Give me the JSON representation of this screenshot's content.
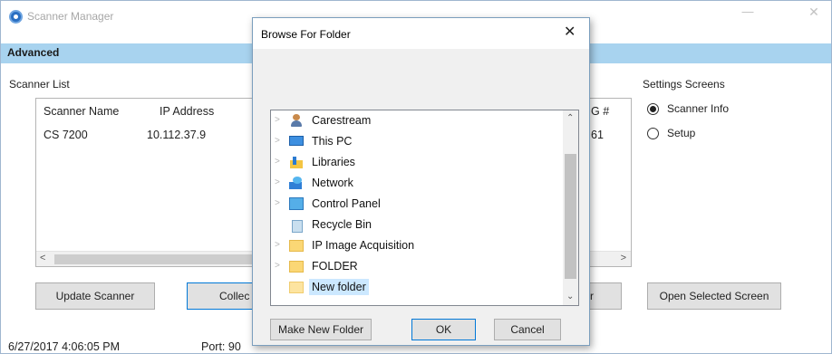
{
  "main_window": {
    "title": "Scanner Manager",
    "minimize_glyph": "—",
    "close_glyph": "✕",
    "tab": "Advanced",
    "scanner_list": {
      "label": "Scanner List",
      "columns": [
        "Scanner Name",
        "IP Address",
        "G #"
      ],
      "rows": [
        {
          "name": "CS 7200",
          "ip": "10.112.37.9",
          "partial": "61"
        }
      ],
      "scroll_left": "<",
      "scroll_right": ">"
    },
    "settings_screens": {
      "label": "Settings Screens",
      "options": [
        {
          "label": "Scanner Info",
          "checked": true
        },
        {
          "label": "Setup",
          "checked": false
        }
      ]
    },
    "buttons": {
      "update_scanner": "Update Scanner",
      "collect_partial": "Collec",
      "right_partial": "r",
      "open_selected_screen": "Open Selected Screen"
    },
    "status": {
      "timestamp": "6/27/2017 4:06:05 PM",
      "port": "Port: 90"
    }
  },
  "dialog": {
    "title": "Browse For Folder",
    "close_glyph": "✕",
    "tree": [
      {
        "label": "Carestream",
        "icon": "person-folder-icon",
        "expandable": true,
        "selected": false
      },
      {
        "label": "This PC",
        "icon": "computer-icon",
        "expandable": true,
        "selected": false
      },
      {
        "label": "Libraries",
        "icon": "libraries-icon",
        "expandable": true,
        "selected": false
      },
      {
        "label": "Network",
        "icon": "network-icon",
        "expandable": true,
        "selected": false
      },
      {
        "label": "Control Panel",
        "icon": "control-panel-icon",
        "expandable": true,
        "selected": false
      },
      {
        "label": "Recycle Bin",
        "icon": "recycle-bin-icon",
        "expandable": false,
        "selected": false
      },
      {
        "label": "IP Image Acquisition",
        "icon": "folder-icon",
        "expandable": true,
        "selected": false
      },
      {
        "label": "FOLDER",
        "icon": "folder-icon",
        "expandable": true,
        "selected": false
      },
      {
        "label": "New folder",
        "icon": "folder-icon",
        "expandable": false,
        "selected": true
      }
    ],
    "buttons": {
      "make_new_folder": "Make New Folder",
      "ok": "OK",
      "cancel": "Cancel"
    }
  },
  "colors": {
    "tab_strip": "#a8d3ef",
    "selection": "#cce8ff",
    "focus_border": "#0078d7"
  }
}
